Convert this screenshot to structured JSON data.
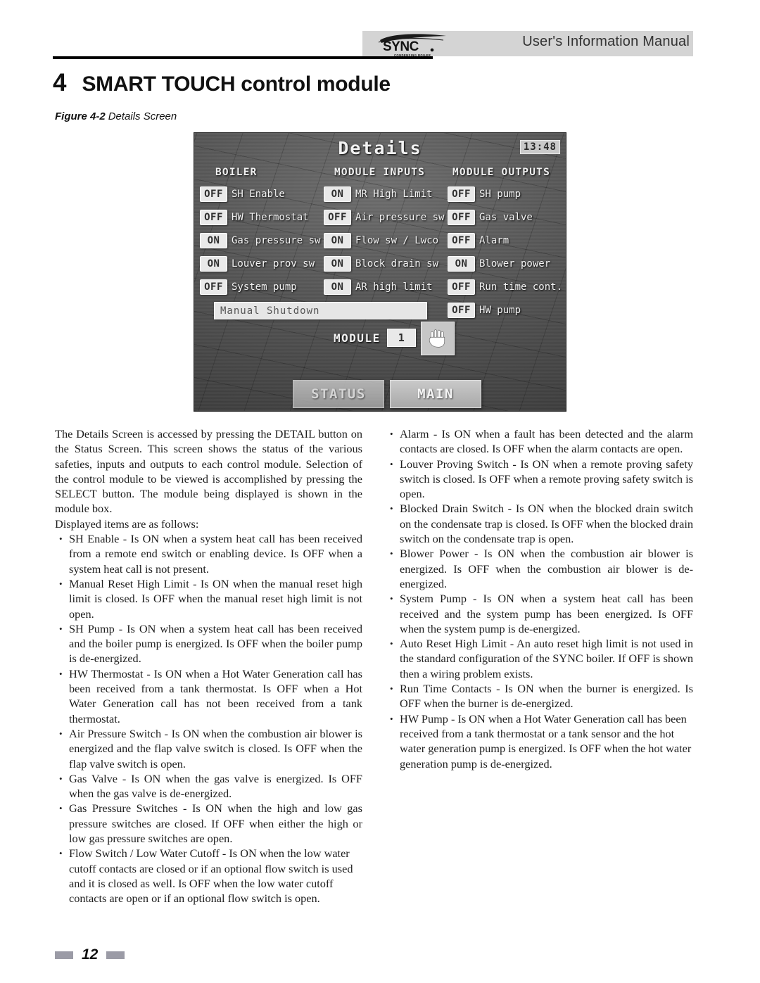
{
  "header": {
    "manual_title": "User's Information Manual",
    "logo_text": "SYNC",
    "logo_subtext": "CONDENSING BOILER"
  },
  "title": {
    "chapter_number": "4",
    "chapter_title": "SMART TOUCH control module"
  },
  "figure": {
    "label": "Figure 4-2",
    "caption": "Details Screen"
  },
  "screen": {
    "title": "Details",
    "clock": "13:48",
    "column_headers": [
      "BOILER",
      "MODULE INPUTS",
      "MODULE OUTPUTS"
    ],
    "boiler": [
      {
        "state": "OFF",
        "label": "SH Enable"
      },
      {
        "state": "OFF",
        "label": "HW Thermostat"
      },
      {
        "state": "ON",
        "label": "Gas pressure sw"
      },
      {
        "state": "ON",
        "label": "Louver prov sw"
      },
      {
        "state": "OFF",
        "label": "System pump"
      }
    ],
    "module_inputs": [
      {
        "state": "ON",
        "label": "MR High Limit"
      },
      {
        "state": "OFF",
        "label": "Air pressure sw"
      },
      {
        "state": "ON",
        "label": "Flow sw / Lwco"
      },
      {
        "state": "ON",
        "label": "Block drain sw"
      },
      {
        "state": "ON",
        "label": "AR high limit"
      }
    ],
    "module_outputs": [
      {
        "state": "OFF",
        "label": "SH pump"
      },
      {
        "state": "OFF",
        "label": "Gas valve"
      },
      {
        "state": "OFF",
        "label": "Alarm"
      },
      {
        "state": "ON",
        "label": "Blower power"
      },
      {
        "state": "OFF",
        "label": "Run time cont."
      },
      {
        "state": "OFF",
        "label": "HW pump"
      }
    ],
    "status_field": "Manual Shutdown",
    "module_label": "MODULE",
    "module_value": "1",
    "hand_icon": "hand-icon",
    "nav_buttons": [
      "STATUS",
      "MAIN"
    ]
  },
  "body": {
    "intro": "The Details Screen is accessed by pressing the DETAIL button on the Status Screen.  This screen shows the status of the various safeties, inputs and outputs to each control module.  Selection of the control module to be viewed is accomplished by pressing the SELECT button.  The module being displayed is shown in the module box.",
    "intro2": "Displayed items are as follows:",
    "left_bullets": [
      "SH Enable -  Is ON when a system heat call has been received from a remote end switch or enabling device.  Is OFF when a system heat call is not present.",
      "Manual Reset High Limit - Is ON when the manual reset high limit is closed.  Is OFF when the manual reset high limit is not open.",
      "SH Pump - Is ON when a system heat call has been received and the boiler pump is energized.  Is OFF when the boiler pump is de-energized.",
      "HW Thermostat - Is ON when a Hot Water Generation call has been received from a tank thermostat.  Is OFF when a Hot Water Generation call has not been received from a tank thermostat.",
      "Air Pressure Switch - Is ON when the combustion air blower is energized and the flap valve switch is closed.  Is OFF when the flap valve switch is open.",
      "Gas Valve - Is ON when the gas valve is energized.  Is OFF when the gas valve is de-energized.",
      "Gas Pressure Switches - Is ON when the high and low gas pressure switches are closed.  If OFF when either the high or low gas pressure switches are open.",
      "Flow Switch / Low Water Cutoff - Is ON when the low water cutoff contacts are closed or if an optional flow switch is used and it is closed as well.  Is OFF when the low water cutoff contacts are open or if an optional flow switch is open."
    ],
    "right_bullets": [
      "Alarm - Is ON when a fault has been detected and the alarm contacts are closed.  Is OFF when the alarm contacts are open.",
      "Louver Proving Switch - Is ON when a remote proving safety switch is closed.  Is OFF when a remote proving safety switch is open.",
      "Blocked Drain Switch - Is ON when the blocked drain switch on the condensate trap is closed.  Is OFF when the blocked drain switch on the condensate trap is open.",
      "Blower Power - Is ON when the combustion air blower is energized.  Is OFF when the combustion air blower is de-energized.",
      "System Pump - Is ON when a system heat call has been received and the system pump has been energized.  Is OFF when the system pump is de-energized.",
      "Auto Reset High Limit - An auto reset high limit is not used in the standard configuration of the SYNC boiler.  If OFF is shown then a wiring problem exists.",
      "Run Time Contacts - Is ON when the burner is energized.  Is OFF when the burner is de-energized.",
      "HW Pump - Is ON when a Hot Water Generation call has been received from a tank thermostat or a tank sensor and the hot water generation pump is energized.  Is OFF when the hot water generation pump is de-energized."
    ]
  },
  "footer": {
    "page_number": "12"
  }
}
